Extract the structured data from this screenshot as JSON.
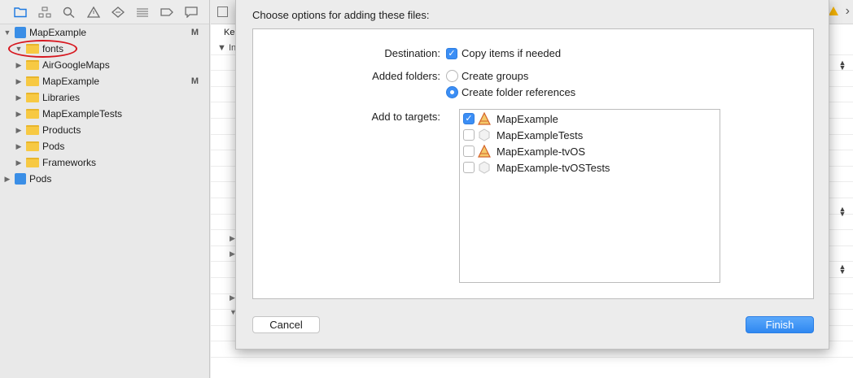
{
  "sidebar": {
    "toolbar_icons": [
      "folder-icon",
      "hierarchy-icon",
      "search-icon",
      "warning-icon",
      "diamond-icon",
      "list-icon",
      "tag-icon",
      "comment-icon"
    ],
    "tree": [
      {
        "label": "MapExample",
        "badge": "M",
        "type": "project",
        "expanded": true,
        "indent": 0
      },
      {
        "label": "fonts",
        "badge": "",
        "type": "folder",
        "expanded": true,
        "indent": 1
      },
      {
        "label": "AirGoogleMaps",
        "badge": "",
        "type": "folder",
        "expanded": false,
        "indent": 1
      },
      {
        "label": "MapExample",
        "badge": "M",
        "type": "folder",
        "expanded": false,
        "indent": 1
      },
      {
        "label": "Libraries",
        "badge": "",
        "type": "folder",
        "expanded": false,
        "indent": 1
      },
      {
        "label": "MapExampleTests",
        "badge": "",
        "type": "folder",
        "expanded": false,
        "indent": 1
      },
      {
        "label": "Products",
        "badge": "",
        "type": "folder",
        "expanded": false,
        "indent": 1
      },
      {
        "label": "Pods",
        "badge": "",
        "type": "folder",
        "expanded": false,
        "indent": 1
      },
      {
        "label": "Frameworks",
        "badge": "",
        "type": "folder",
        "expanded": false,
        "indent": 1
      },
      {
        "label": "Pods",
        "badge": "",
        "type": "project",
        "expanded": false,
        "indent": 0
      }
    ]
  },
  "editor": {
    "column_key": "Ke",
    "info_row": "Inf"
  },
  "sheet": {
    "title": "Choose options for adding these files:",
    "destination_label": "Destination:",
    "copy_items_label": "Copy items if needed",
    "copy_items_checked": true,
    "added_folders_label": "Added folders:",
    "create_groups_label": "Create groups",
    "create_folder_refs_label": "Create folder references",
    "selected_folder_option": "Create folder references",
    "targets_label": "Add to targets:",
    "targets": [
      {
        "label": "MapExample",
        "checked": true,
        "icon": "app-icon"
      },
      {
        "label": "MapExampleTests",
        "checked": false,
        "icon": "test-bundle-icon"
      },
      {
        "label": "MapExample-tvOS",
        "checked": false,
        "icon": "app-icon"
      },
      {
        "label": "MapExample-tvOSTests",
        "checked": false,
        "icon": "test-bundle-icon"
      }
    ],
    "cancel_label": "Cancel",
    "finish_label": "Finish"
  },
  "colors": {
    "accent": "#3b8ef5",
    "highlight_oval": "#d7171f",
    "folder": "#f7c943"
  }
}
